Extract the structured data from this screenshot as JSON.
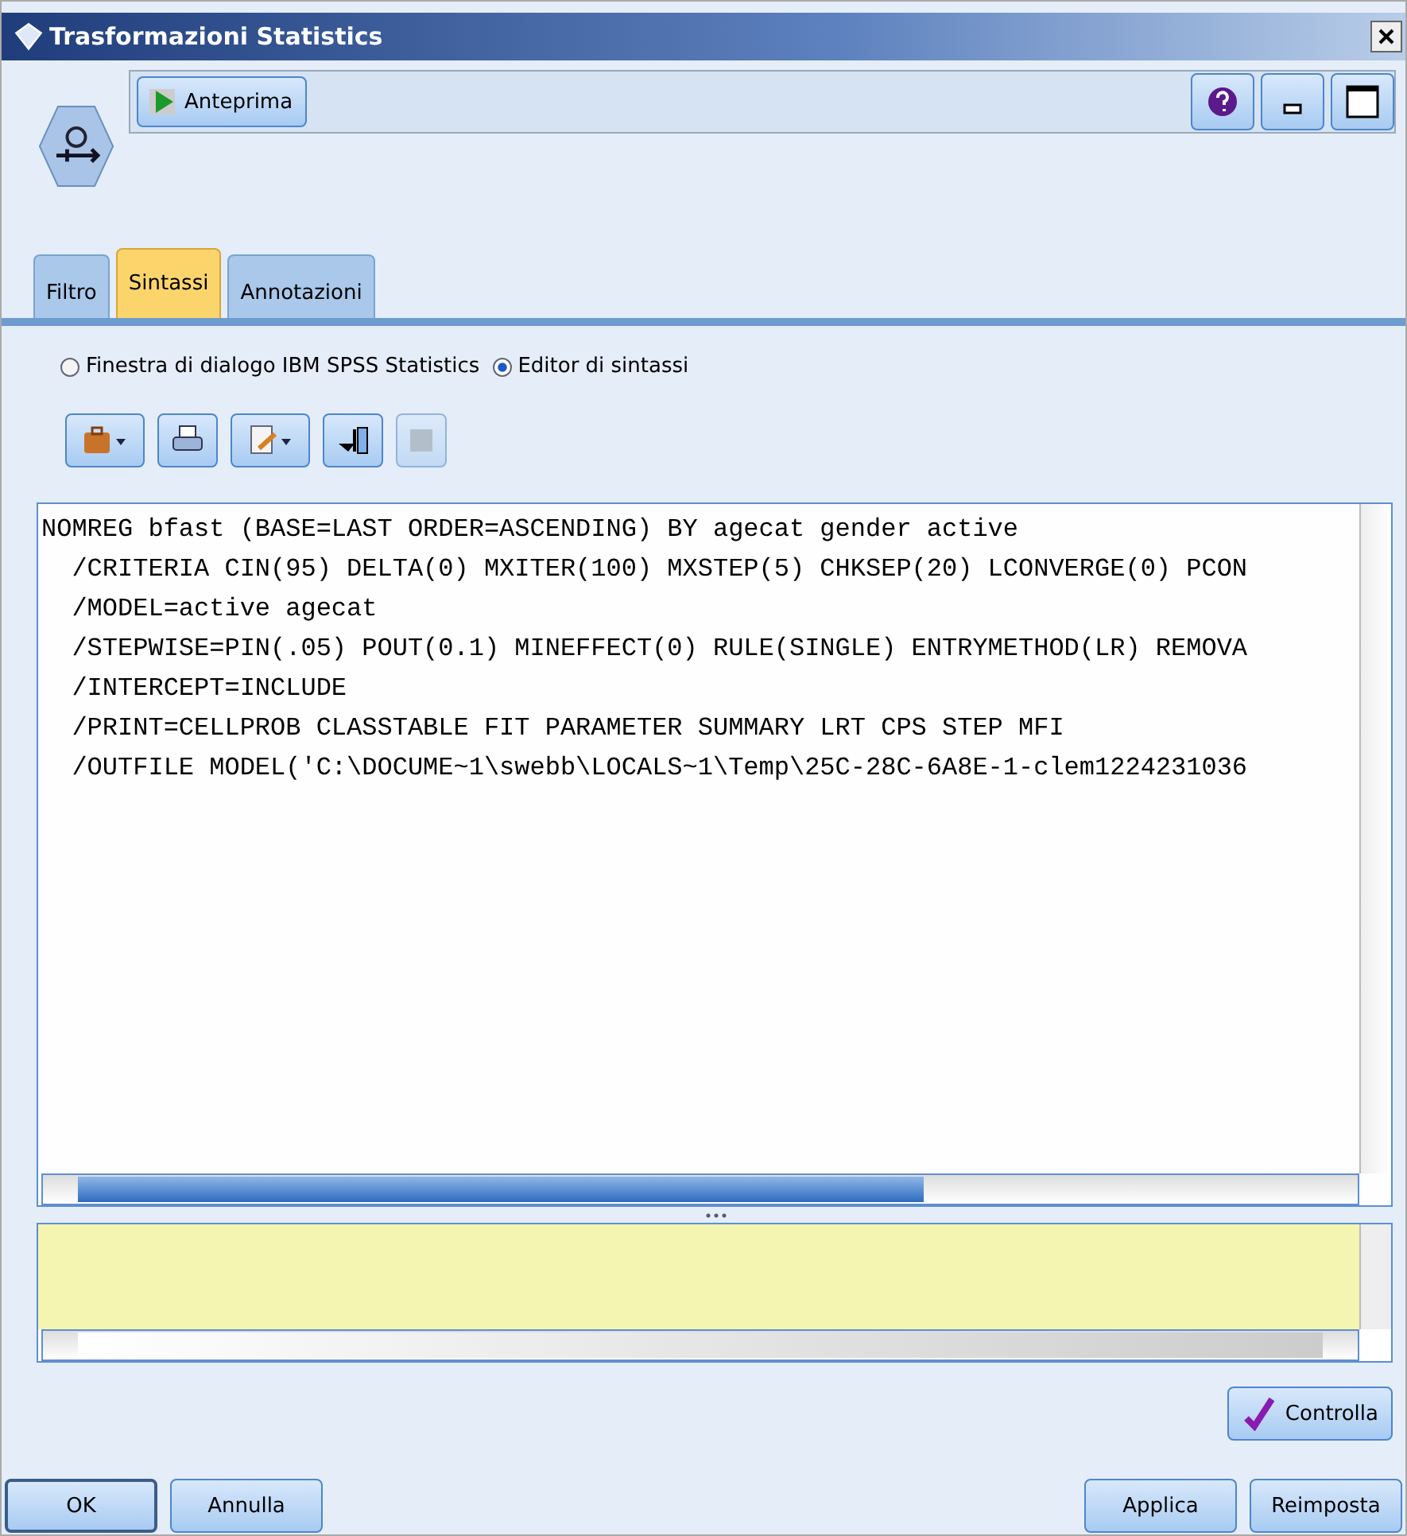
{
  "window": {
    "title": "Trasformazioni Statistics"
  },
  "toolbar": {
    "preview_button": "Anteprima"
  },
  "tabs": [
    {
      "label": "Filtro",
      "selected": false
    },
    {
      "label": "Sintassi",
      "selected": true
    },
    {
      "label": "Annotazioni",
      "selected": false
    }
  ],
  "mode_options": [
    {
      "label": "Finestra di dialogo IBM SPSS Statistics",
      "selected": false
    },
    {
      "label": "Editor di sintassi",
      "selected": true
    }
  ],
  "editor": {
    "lines": [
      "NOMREG bfast (BASE=LAST ORDER=ASCENDING) BY agecat gender active",
      "  /CRITERIA CIN(95) DELTA(0) MXITER(100) MXSTEP(5) CHKSEP(20) LCONVERGE(0) PCON",
      "  /MODEL=active agecat",
      "  /STEPWISE=PIN(.05) POUT(0.1) MINEFFECT(0) RULE(SINGLE) ENTRYMETHOD(LR) REMOVA",
      "  /INTERCEPT=INCLUDE",
      "  /PRINT=CELLPROB CLASSTABLE FIT PARAMETER SUMMARY LRT CPS STEP MFI",
      "  /OUTFILE MODEL('C:\\DOCUME~1\\swebb\\LOCALS~1\\Temp\\25C-28C-6A8E-1-clem1224231036"
    ]
  },
  "check_button": "Controlla",
  "buttons": [
    {
      "label": "OK",
      "kind": "default"
    },
    {
      "label": "Annulla",
      "kind": "normal"
    },
    {
      "label": "Applica",
      "kind": "normal"
    },
    {
      "label": "Reimposta",
      "kind": "normal"
    }
  ]
}
